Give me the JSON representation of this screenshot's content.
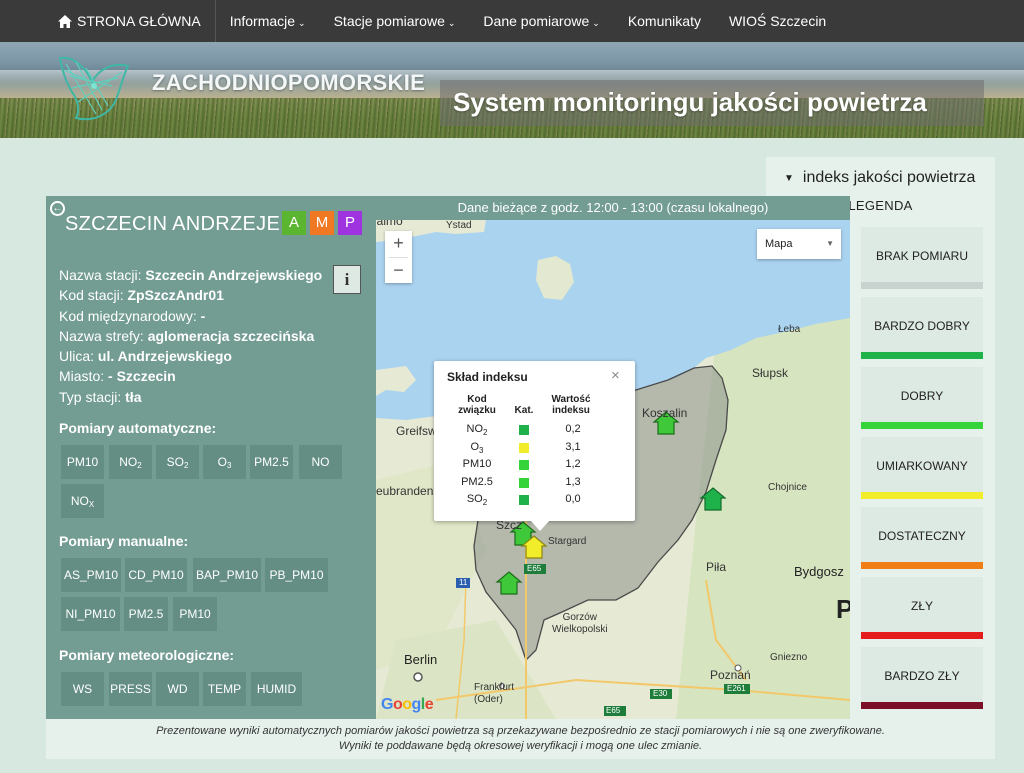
{
  "nav": {
    "home": "STRONA GŁÓWNA",
    "items": [
      {
        "label": "Informacje",
        "caret": true
      },
      {
        "label": "Stacje pomiarowe",
        "caret": true
      },
      {
        "label": "Dane pomiarowe",
        "caret": true
      },
      {
        "label": "Komunikaty",
        "caret": false
      },
      {
        "label": "WIOŚ Szczecin",
        "caret": false
      }
    ]
  },
  "banner": {
    "region": "ZACHODNIOPOMORSKIE",
    "system": "System monitoringu jakości powietrza"
  },
  "legend": {
    "title": "indeks jakości powietrza",
    "subtitle": "LEGENDA",
    "items": [
      {
        "label": "BRAK POMIARU",
        "color": "#c8d2cf"
      },
      {
        "label": "BARDZO DOBRY",
        "color": "#1fb24a"
      },
      {
        "label": "DOBRY",
        "color": "#34d43a"
      },
      {
        "label": "UMIARKOWANY",
        "color": "#f1ed2a"
      },
      {
        "label": "DOSTATECZNY",
        "color": "#f07e15"
      },
      {
        "label": "ZŁY",
        "color": "#e51c1c"
      },
      {
        "label": "BARDZO ZŁY",
        "color": "#7a0f27"
      }
    ]
  },
  "station": {
    "name": "SZCZECIN ANDRZEJE...",
    "badges": [
      {
        "label": "A",
        "color": "#5cb531"
      },
      {
        "label": "M",
        "color": "#f07822"
      },
      {
        "label": "P",
        "color": "#a033e0"
      }
    ],
    "info_icon": "i",
    "props": [
      {
        "label": "Nazwa stacji: ",
        "value": "Szczecin Andrzejewskiego"
      },
      {
        "label": "Kod stacji: ",
        "value": "ZpSzczAndr01"
      },
      {
        "label": "Kod międzynarodowy: ",
        "value": "-"
      },
      {
        "label": "Nazwa strefy: ",
        "value": "aglomeracja szczecińska"
      },
      {
        "label": "Ulica: ",
        "value": "ul. Andrzejewskiego"
      },
      {
        "label": "Miasto: ",
        "value": "- Szczecin"
      },
      {
        "label": "Typ stacji: ",
        "value": "tła"
      }
    ],
    "automatic_title": "Pomiary automatyczne:",
    "automatic": [
      {
        "base": "PM10",
        "sub": ""
      },
      {
        "base": "NO",
        "sub": "2"
      },
      {
        "base": "SO",
        "sub": "2"
      },
      {
        "base": "O",
        "sub": "3"
      },
      {
        "base": "PM2.5",
        "sub": ""
      },
      {
        "base": "NO",
        "sub": ""
      },
      {
        "base": "NO",
        "sub": "X"
      }
    ],
    "manual_title": "Pomiary manualne:",
    "manual": [
      "AS_PM10",
      "CD_PM10",
      "BAP_PM10",
      "PB_PM10",
      "NI_PM10",
      "PM2.5",
      "PM10"
    ],
    "meteo_title": "Pomiary meteorologiczne:",
    "meteo": [
      "WS",
      "PRESS",
      "WD",
      "TEMP",
      "HUMID"
    ]
  },
  "map": {
    "header": "Dane bieżące z godz. 12:00 - 13:00 (czasu lokalnego)",
    "zoom_in": "+",
    "zoom_out": "−",
    "map_type": "Mapa",
    "labels": {
      "malmo": "lalmö",
      "ystad": "Ystad",
      "leba": "Łeba",
      "slupsk": "Słupsk",
      "koszalin": "Koszalin",
      "greifswald": "Greifsw",
      "neubrandenburg": "eubrandenburg",
      "szczecin": "Szcz",
      "stargard": "Stargard",
      "chojnice": "Chojnice",
      "bydgoszcz": "Bydgosz",
      "pila": "Piła",
      "gorzow": "Gorzów\nWielkopolski",
      "berlin": "Berlin",
      "frankfurt": "Frankfurt\n(Oder)",
      "poznan": "Poznań",
      "gniezno": "Gniezno",
      "road_e65a": "E65",
      "road_e65b": "E65",
      "road_e30": "E30",
      "road_e261": "E261",
      "road_11": "11",
      "big_p": "P"
    },
    "google": "Google"
  },
  "popup": {
    "title": "Skład indeksu",
    "close": "×",
    "col_code": "Kod\nzwiązku",
    "col_cat": "Kat.",
    "col_val": "Wartość\nindeksu",
    "rows": [
      {
        "base": "NO",
        "sub": "2",
        "color": "#1fb24a",
        "value": "0,2"
      },
      {
        "base": "O",
        "sub": "3",
        "color": "#f1ed2a",
        "value": "3,1"
      },
      {
        "base": "PM10",
        "sub": "",
        "color": "#34d43a",
        "value": "1,2"
      },
      {
        "base": "PM2.5",
        "sub": "",
        "color": "#34d43a",
        "value": "1,3"
      },
      {
        "base": "SO",
        "sub": "2",
        "color": "#1fb24a",
        "value": "0,0"
      }
    ]
  },
  "note": {
    "line1": "Prezentowane wyniki automatycznych pomiarów jakości powietrza są przekazywane bezpośrednio ze stacji pomiarowych i nie są one zweryfikowane.",
    "line2": "Wyniki te poddawane będą okresowej weryfikacji i mogą one ulec zmianie."
  }
}
